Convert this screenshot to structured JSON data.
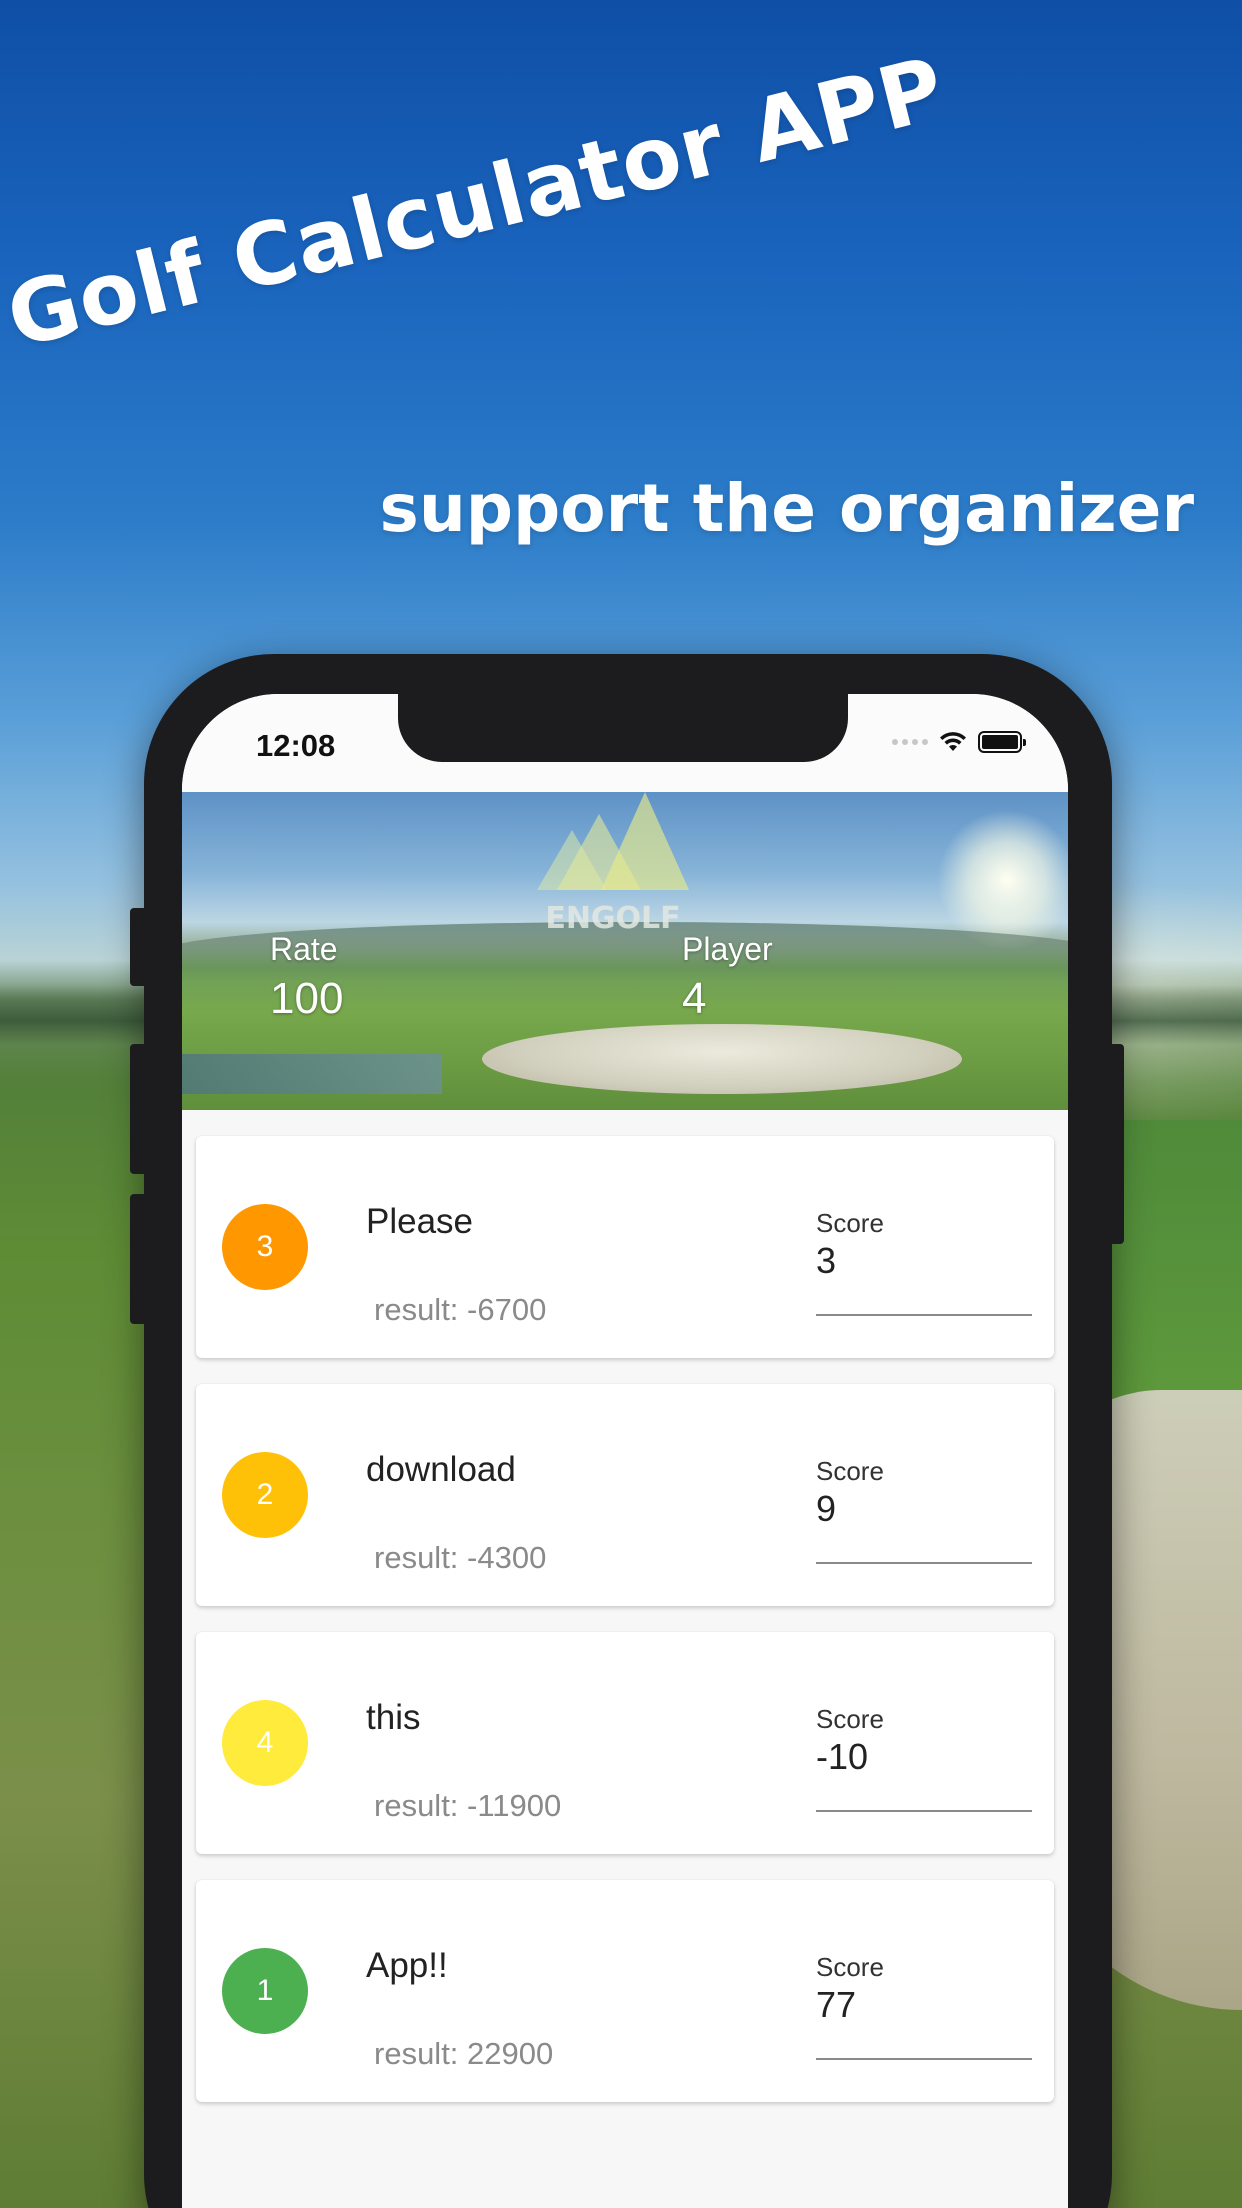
{
  "promo": {
    "headline": "Golf Calculator APP",
    "subline": "support the organizer"
  },
  "status_bar": {
    "time": "12:08",
    "icons": [
      "signal-icon",
      "wifi-icon",
      "battery-icon"
    ]
  },
  "header": {
    "logo_text": "ENGOLF",
    "rate_label": "Rate",
    "rate_value": "100",
    "player_label": "Player",
    "player_value": "4"
  },
  "players": [
    {
      "rank": "3",
      "rank_color": "#FF9800",
      "name": "Please",
      "result": "result: -6700",
      "score_label": "Score",
      "score": "3"
    },
    {
      "rank": "2",
      "rank_color": "#FFC107",
      "name": "download",
      "result": "result: -4300",
      "score_label": "Score",
      "score": "9"
    },
    {
      "rank": "4",
      "rank_color": "#FFEB3B",
      "name": "this",
      "result": "result: -11900",
      "score_label": "Score",
      "score": "-10"
    },
    {
      "rank": "1",
      "rank_color": "#4CAF50",
      "name": "App!!",
      "result": "result: 22900",
      "score_label": "Score",
      "score": "77"
    }
  ]
}
